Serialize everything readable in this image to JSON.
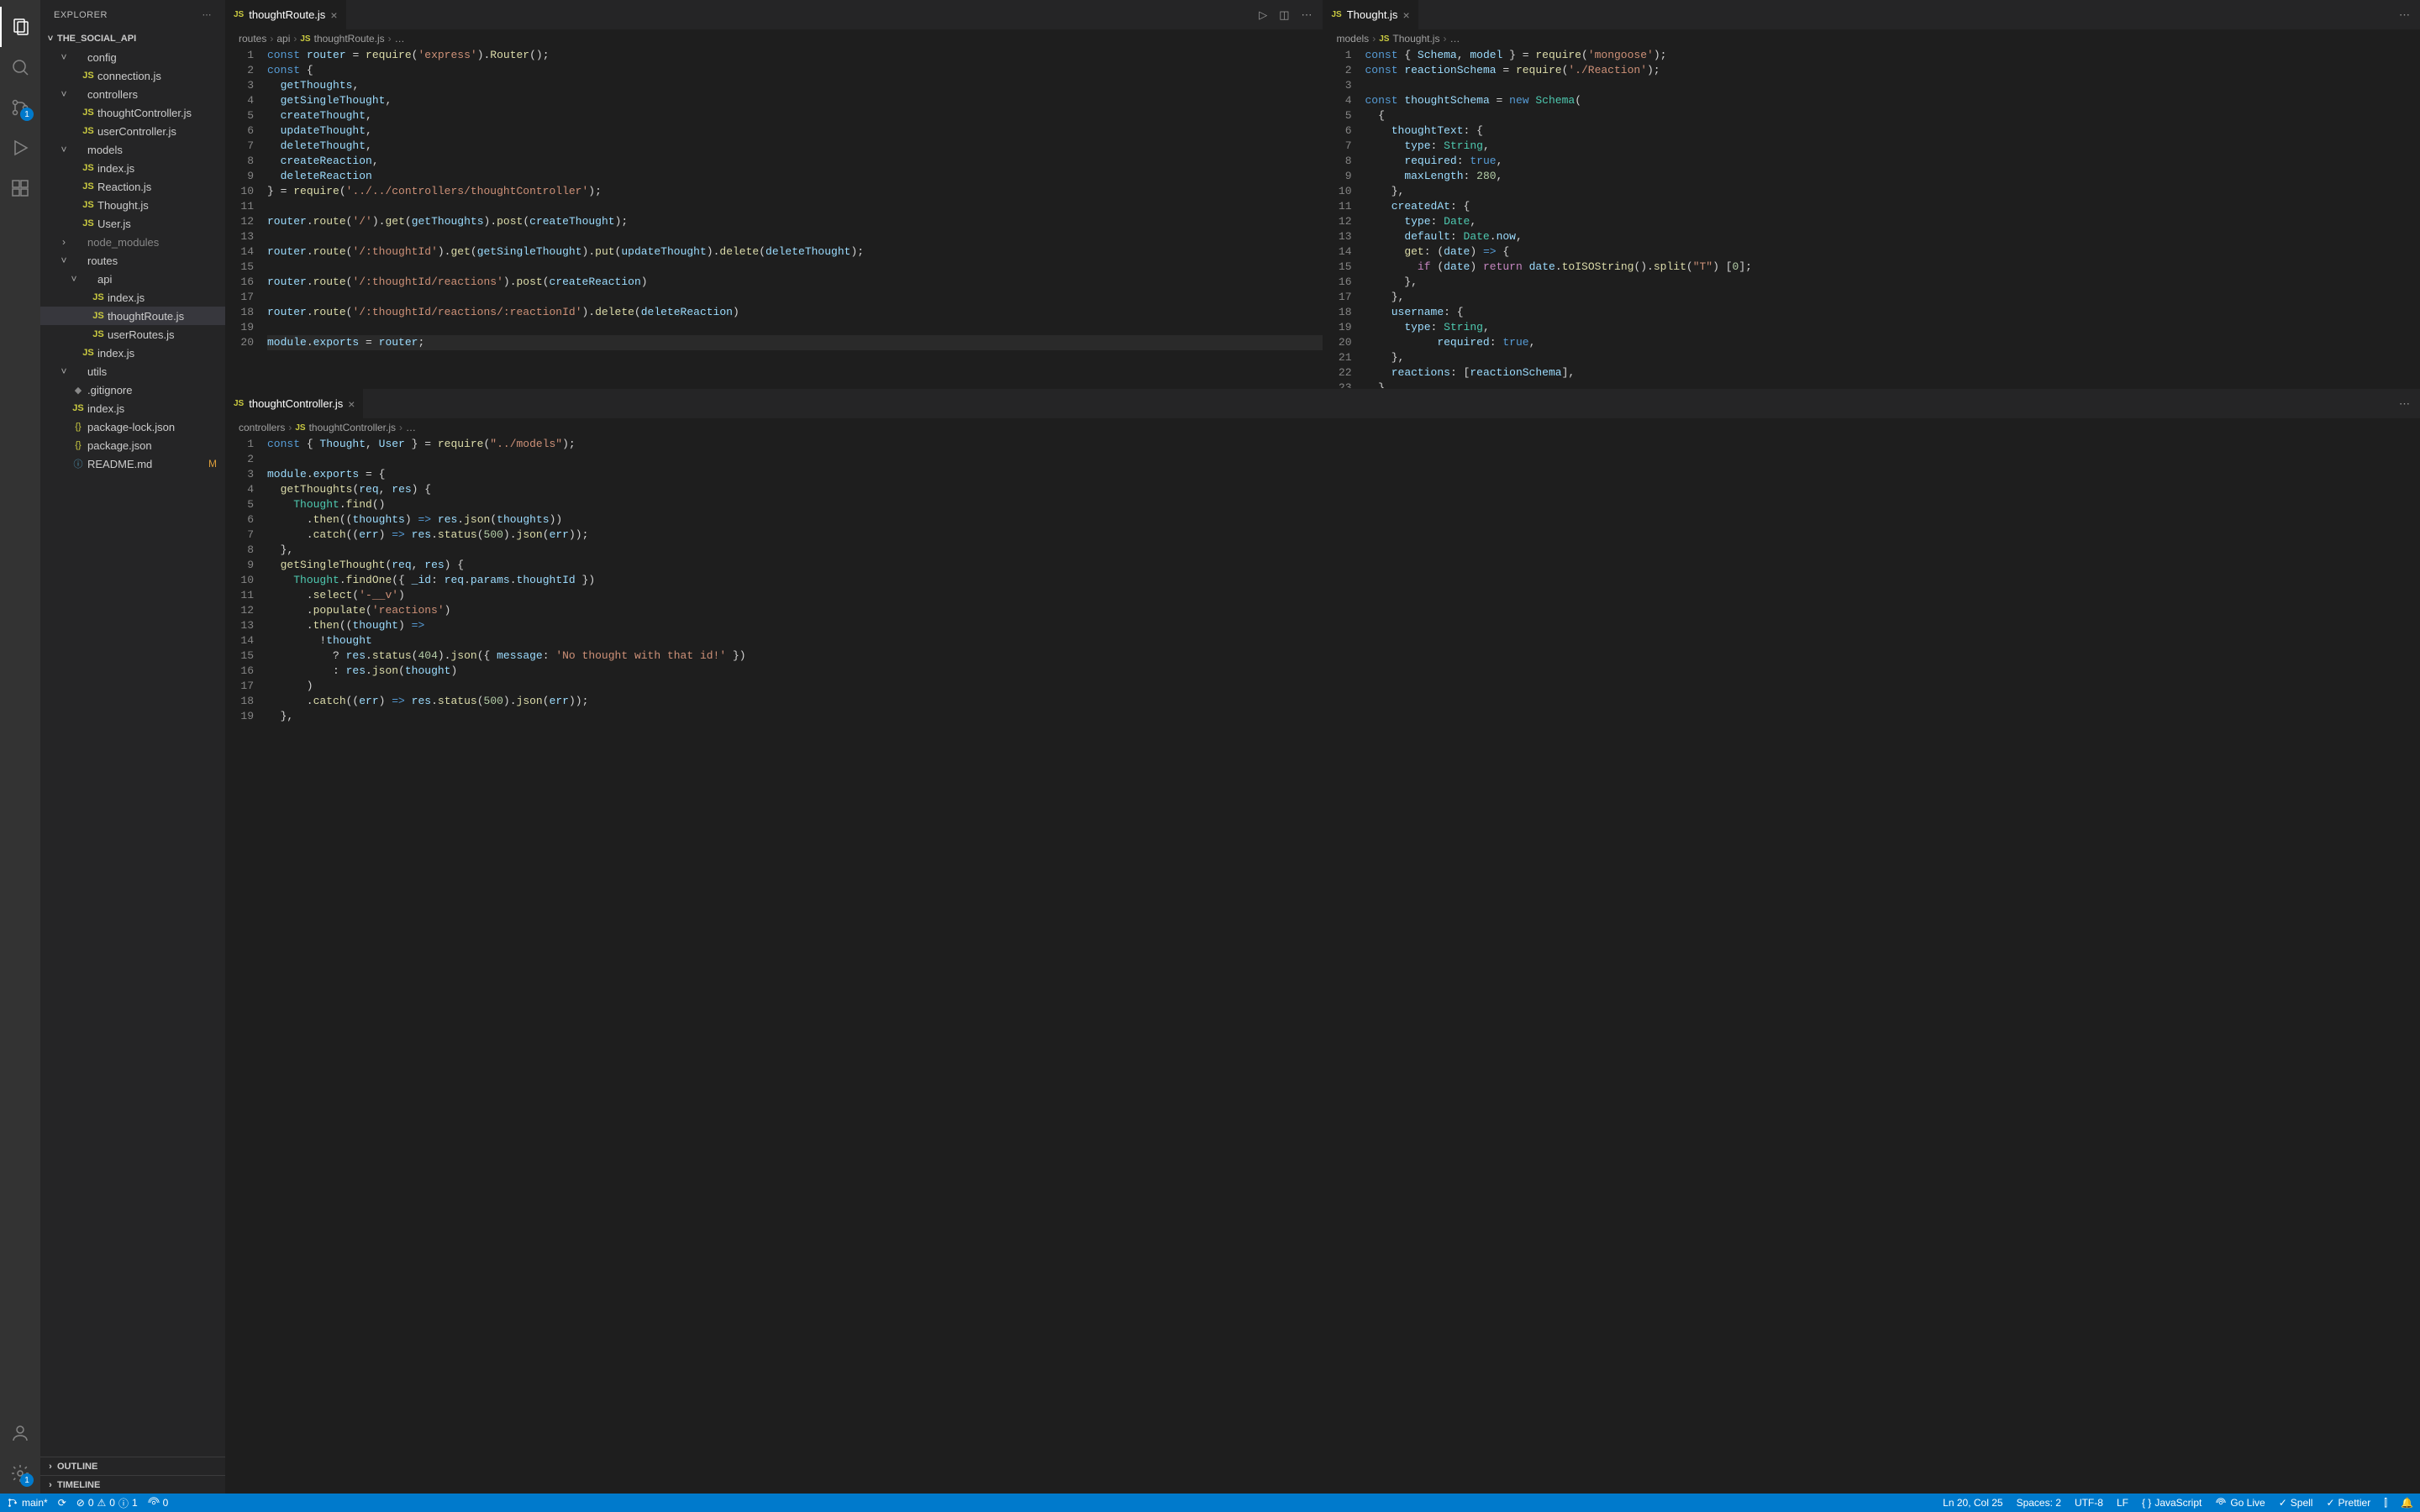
{
  "sidebar": {
    "title": "EXPLORER",
    "project": "THE_SOCIAL_API",
    "outline": "OUTLINE",
    "timeline": "TIMELINE",
    "tree": [
      {
        "indent": 1,
        "chev": "˅",
        "icon": "",
        "label": "config"
      },
      {
        "indent": 2,
        "chev": "",
        "icon": "JS",
        "iconClass": "icon-js",
        "label": "connection.js"
      },
      {
        "indent": 1,
        "chev": "˅",
        "icon": "",
        "label": "controllers"
      },
      {
        "indent": 2,
        "chev": "",
        "icon": "JS",
        "iconClass": "icon-js",
        "label": "thoughtController.js"
      },
      {
        "indent": 2,
        "chev": "",
        "icon": "JS",
        "iconClass": "icon-js",
        "label": "userController.js"
      },
      {
        "indent": 1,
        "chev": "˅",
        "icon": "",
        "label": "models"
      },
      {
        "indent": 2,
        "chev": "",
        "icon": "JS",
        "iconClass": "icon-js",
        "label": "index.js"
      },
      {
        "indent": 2,
        "chev": "",
        "icon": "JS",
        "iconClass": "icon-js",
        "label": "Reaction.js"
      },
      {
        "indent": 2,
        "chev": "",
        "icon": "JS",
        "iconClass": "icon-js",
        "label": "Thought.js"
      },
      {
        "indent": 2,
        "chev": "",
        "icon": "JS",
        "iconClass": "icon-js",
        "label": "User.js"
      },
      {
        "indent": 1,
        "chev": "›",
        "icon": "",
        "label": "node_modules",
        "dim": true
      },
      {
        "indent": 1,
        "chev": "˅",
        "icon": "",
        "label": "routes"
      },
      {
        "indent": 2,
        "chev": "˅",
        "icon": "",
        "label": "api"
      },
      {
        "indent": 3,
        "chev": "",
        "icon": "JS",
        "iconClass": "icon-js",
        "label": "index.js"
      },
      {
        "indent": 3,
        "chev": "",
        "icon": "JS",
        "iconClass": "icon-js",
        "label": "thoughtRoute.js",
        "selected": true
      },
      {
        "indent": 3,
        "chev": "",
        "icon": "JS",
        "iconClass": "icon-js",
        "label": "userRoutes.js"
      },
      {
        "indent": 2,
        "chev": "",
        "icon": "JS",
        "iconClass": "icon-js",
        "label": "index.js"
      },
      {
        "indent": 1,
        "chev": "˅",
        "icon": "",
        "label": "utils"
      },
      {
        "indent": 1,
        "chev": "",
        "icon": "◆",
        "iconClass": "icon-git",
        "label": ".gitignore"
      },
      {
        "indent": 1,
        "chev": "",
        "icon": "JS",
        "iconClass": "icon-js",
        "label": "index.js"
      },
      {
        "indent": 1,
        "chev": "",
        "icon": "{}",
        "iconClass": "icon-json",
        "label": "package-lock.json"
      },
      {
        "indent": 1,
        "chev": "",
        "icon": "{}",
        "iconClass": "icon-json",
        "label": "package.json"
      },
      {
        "indent": 1,
        "chev": "",
        "icon": "ⓘ",
        "iconClass": "icon-md",
        "label": "README.md",
        "status": "M"
      }
    ]
  },
  "pane1": {
    "tab": "thoughtRoute.js",
    "breadcrumb": [
      "routes",
      "api",
      "thoughtRoute.js",
      "…"
    ],
    "lines": [
      "<span class='kw'>const</span> <span class='var'>router</span> = <span class='fn'>require</span>(<span class='str'>'express'</span>).<span class='fn'>Router</span>();",
      "<span class='kw'>const</span> {",
      "  <span class='var'>getThoughts</span>,",
      "  <span class='var'>getSingleThought</span>,",
      "  <span class='var'>createThought</span>,",
      "  <span class='var'>updateThought</span>,",
      "  <span class='var'>deleteThought</span>,",
      "  <span class='var'>createReaction</span>,",
      "  <span class='var'>deleteReaction</span>",
      "} = <span class='fn'>require</span>(<span class='str'>'../../controllers/thoughtController'</span>);",
      "",
      "<span class='var'>router</span>.<span class='fn'>route</span>(<span class='str'>'/'</span>).<span class='fn'>get</span>(<span class='var'>getThoughts</span>).<span class='fn'>post</span>(<span class='var'>createThought</span>);",
      "",
      "<span class='var'>router</span>.<span class='fn'>route</span>(<span class='str'>'/:thoughtId'</span>).<span class='fn'>get</span>(<span class='var'>getSingleThought</span>).<span class='fn'>put</span>(<span class='var'>updateThought</span>).<span class='fn'>delete</span>(<span class='var'>deleteThought</span>);",
      "",
      "<span class='var'>router</span>.<span class='fn'>route</span>(<span class='str'>'/:thoughtId/reactions'</span>).<span class='fn'>post</span>(<span class='var'>createReaction</span>)",
      "",
      "<span class='var'>router</span>.<span class='fn'>route</span>(<span class='str'>'/:thoughtId/reactions/:reactionId'</span>).<span class='fn'>delete</span>(<span class='var'>deleteReaction</span>)",
      "",
      "<span class='var'>module</span>.<span class='var'>exports</span> = <span class='var'>router</span>;"
    ]
  },
  "pane2": {
    "tab": "Thought.js",
    "breadcrumb": [
      "models",
      "Thought.js",
      "…"
    ],
    "lines": [
      "<span class='kw'>const</span> { <span class='var'>Schema</span>, <span class='var'>model</span> } = <span class='fn'>require</span>(<span class='str'>'mongoose'</span>);",
      "<span class='kw'>const</span> <span class='var'>reactionSchema</span> = <span class='fn'>require</span>(<span class='str'>'./Reaction'</span>);",
      "",
      "<span class='kw'>const</span> <span class='var'>thoughtSchema</span> = <span class='kw'>new</span> <span class='type'>Schema</span>(",
      "  {",
      "    <span class='prop'>thoughtText</span>: {",
      "      <span class='prop'>type</span>: <span class='type'>String</span>,",
      "      <span class='prop'>required</span>: <span class='const2'>true</span>,",
      "      <span class='prop'>maxLength</span>: <span class='num'>280</span>,",
      "    },",
      "    <span class='prop'>createdAt</span>: {",
      "      <span class='prop'>type</span>: <span class='type'>Date</span>,",
      "      <span class='prop'>default</span>: <span class='type'>Date</span>.<span class='var'>now</span>,",
      "      <span class='fn'>get</span>: (<span class='var'>date</span>) <span class='kw'>=></span> {",
      "        <span class='kw2'>if</span> (<span class='var'>date</span>) <span class='kw2'>return</span> <span class='var'>date</span>.<span class='fn'>toISOString</span>().<span class='fn'>split</span>(<span class='str'>\"T\"</span>) [<span class='num'>0</span>];",
      "      },",
      "    },",
      "    <span class='prop'>username</span>: {",
      "      <span class='prop'>type</span>: <span class='type'>String</span>,",
      "           <span class='prop'>required</span>: <span class='const2'>true</span>,",
      "    },",
      "    <span class='prop'>reactions</span>: [<span class='var'>reactionSchema</span>],",
      "  },",
      "  {"
    ]
  },
  "pane3": {
    "tab": "thoughtController.js",
    "breadcrumb": [
      "controllers",
      "thoughtController.js",
      "…"
    ],
    "lines": [
      "<span class='kw'>const</span> { <span class='var'>Thought</span>, <span class='var'>User</span> } = <span class='fn'>require</span>(<span class='str'>\"../models\"</span>);",
      "",
      "<span class='var'>module</span>.<span class='var'>exports</span> = {",
      "  <span class='fn'>getThoughts</span>(<span class='var'>req</span>, <span class='var'>res</span>) {",
      "    <span class='type'>Thought</span>.<span class='fn'>find</span>()",
      "      .<span class='fn'>then</span>((<span class='var'>thoughts</span>) <span class='kw'>=></span> <span class='var'>res</span>.<span class='fn'>json</span>(<span class='var'>thoughts</span>))",
      "      .<span class='fn'>catch</span>((<span class='var'>err</span>) <span class='kw'>=></span> <span class='var'>res</span>.<span class='fn'>status</span>(<span class='num'>500</span>).<span class='fn'>json</span>(<span class='var'>err</span>));",
      "  },",
      "  <span class='fn'>getSingleThought</span>(<span class='var'>req</span>, <span class='var'>res</span>) {",
      "    <span class='type'>Thought</span>.<span class='fn'>findOne</span>({ <span class='prop'>_id</span>: <span class='var'>req</span>.<span class='var'>params</span>.<span class='var'>thoughtId</span> })",
      "      .<span class='fn'>select</span>(<span class='str'>'-__v'</span>)",
      "      .<span class='fn'>populate</span>(<span class='str'>'reactions'</span>)",
      "      .<span class='fn'>then</span>((<span class='var'>thought</span>) <span class='kw'>=></span>",
      "        !<span class='var'>thought</span>",
      "          ? <span class='var'>res</span>.<span class='fn'>status</span>(<span class='num'>404</span>).<span class='fn'>json</span>({ <span class='prop'>message</span>: <span class='str'>'No thought with that id!'</span> })",
      "          : <span class='var'>res</span>.<span class='fn'>json</span>(<span class='var'>thought</span>)",
      "      )",
      "      .<span class='fn'>catch</span>((<span class='var'>err</span>) <span class='kw'>=></span> <span class='var'>res</span>.<span class='fn'>status</span>(<span class='num'>500</span>).<span class='fn'>json</span>(<span class='var'>err</span>));",
      "  },"
    ]
  },
  "statusbar": {
    "branch": "main*",
    "sync": "⟳",
    "errors": "0",
    "warnings": "0",
    "info": "1",
    "ports": "0",
    "ln_col": "Ln 20, Col 25",
    "spaces": "Spaces: 2",
    "encoding": "UTF-8",
    "eol": "LF",
    "lang": "JavaScript",
    "golive": "Go Live",
    "spell": "Spell",
    "prettier": "Prettier"
  },
  "activity_badges": {
    "scm": "1",
    "settings": "1"
  }
}
